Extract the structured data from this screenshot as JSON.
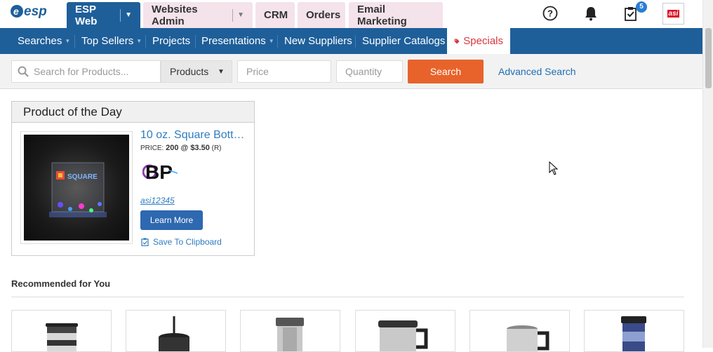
{
  "brand": {
    "logo_text": "esp"
  },
  "tabs": [
    {
      "label": "ESP Web",
      "active": true
    },
    {
      "label": "Websites Admin",
      "active": false
    },
    {
      "label": "CRM",
      "active": false
    },
    {
      "label": "Orders",
      "active": false
    },
    {
      "label": "Email Marketing",
      "active": false
    }
  ],
  "top_icons": {
    "tasks_badge": "5",
    "asi_logo": "asi"
  },
  "nav": {
    "items": [
      {
        "label": "Searches",
        "has_caret": true
      },
      {
        "label": "Top Sellers",
        "has_caret": true
      },
      {
        "label": "Projects",
        "has_caret": false
      },
      {
        "label": "Presentations",
        "has_caret": true
      },
      {
        "label": "New Suppliers",
        "has_caret": false
      },
      {
        "label": "Supplier Catalogs",
        "has_caret": false
      },
      {
        "label": "Specials",
        "has_caret": false,
        "highlighted": true
      }
    ]
  },
  "search": {
    "product_placeholder": "Search for Products...",
    "type_selected": "Products",
    "price_placeholder": "Price",
    "quantity_placeholder": "Quantity",
    "search_button": "Search",
    "advanced_link": "Advanced Search"
  },
  "potd": {
    "heading": "Product of the Day",
    "title": "10 oz. Square Bott…",
    "price_label": "PRICE:",
    "price_value": "200 @ $3.50",
    "price_code": "(R)",
    "supplier_logo": "BP",
    "image_text": "SQUARE",
    "asi_number": "asi12345",
    "learn_more": "Learn More",
    "save_clipboard": "Save To Clipboard"
  },
  "recommended": {
    "heading": "Recommended for You"
  },
  "colors": {
    "primary_blue": "#1e5f9a",
    "tab_pink": "#f4e3ea",
    "search_orange": "#e8632b",
    "link_blue": "#2f7cc0",
    "specials_red": "#d9363e"
  }
}
